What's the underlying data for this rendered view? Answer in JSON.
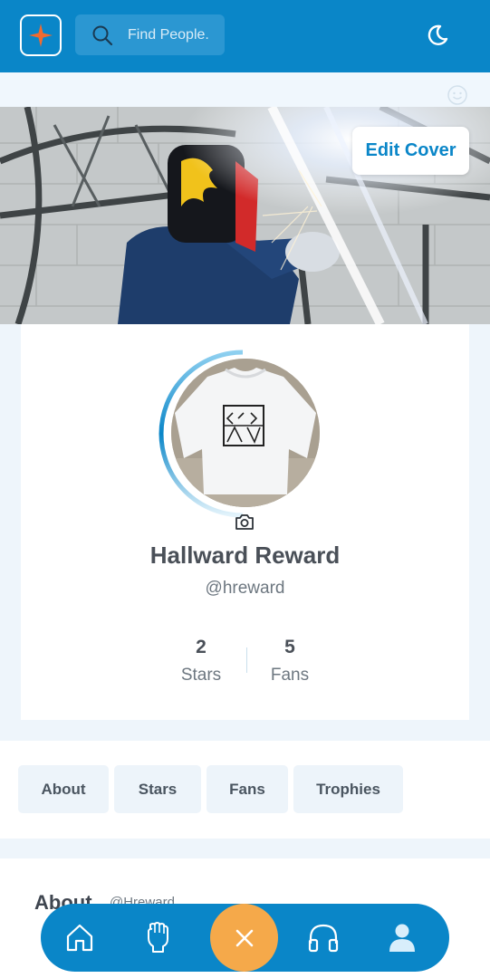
{
  "header": {
    "search_placeholder": "Find People."
  },
  "cover": {
    "edit_label": "Edit Cover"
  },
  "profile": {
    "name": "Hallward Reward",
    "handle": "@hreward",
    "stats": [
      {
        "value": "2",
        "label": "Stars"
      },
      {
        "value": "5",
        "label": "Fans"
      }
    ]
  },
  "tabs": [
    {
      "label": "About"
    },
    {
      "label": "Stars"
    },
    {
      "label": "Fans"
    },
    {
      "label": "Trophies"
    }
  ],
  "about": {
    "title": "About",
    "handle": "@Hreward"
  },
  "bottom_nav": {
    "items": [
      "home-icon",
      "raised-fist-icon",
      "close-icon",
      "headphones-icon",
      "profile-icon"
    ]
  },
  "colors": {
    "primary": "#0a86c8",
    "accent": "#f5a94a",
    "logo_star": "#f26a2e"
  }
}
